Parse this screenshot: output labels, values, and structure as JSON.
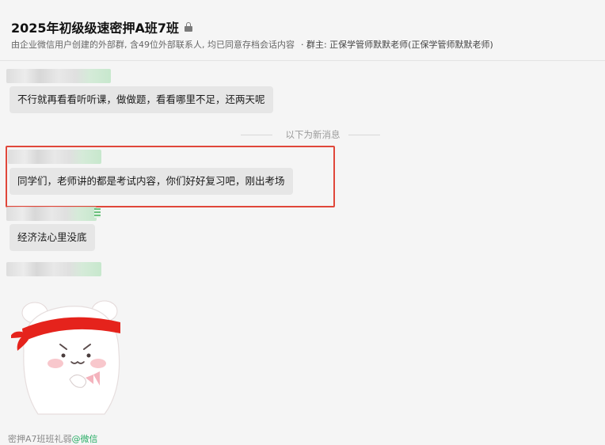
{
  "header": {
    "title": "2025年初级级速密押A班7班",
    "subtitle": "由企业微信用户创建的外部群, 含49位外部联系人, 均已同意存档会话内容",
    "owner": "· 群主: 正保学管师默默老师(正保学管师默默老师)"
  },
  "messages": [
    {
      "text": "不行就再看看听听课，做做题，看看哪里不足，还两天呢"
    },
    {
      "text": "同学们，老师讲的都是考试内容，你们好好复习吧，刚出考场"
    },
    {
      "text": "经济法心里没底"
    }
  ],
  "divider": {
    "text": "以下为新消息"
  },
  "footer": {
    "name": "密押A7班班礼弱",
    "at": "@",
    "platform": "微信"
  },
  "colors": {
    "highlight_border": "#e0473a",
    "bubble_bg": "#e6e6e6",
    "wechat_green": "#2aae67"
  },
  "icons": {
    "lock": "lock-icon",
    "sticker": "red-headband-bear-sticker"
  }
}
